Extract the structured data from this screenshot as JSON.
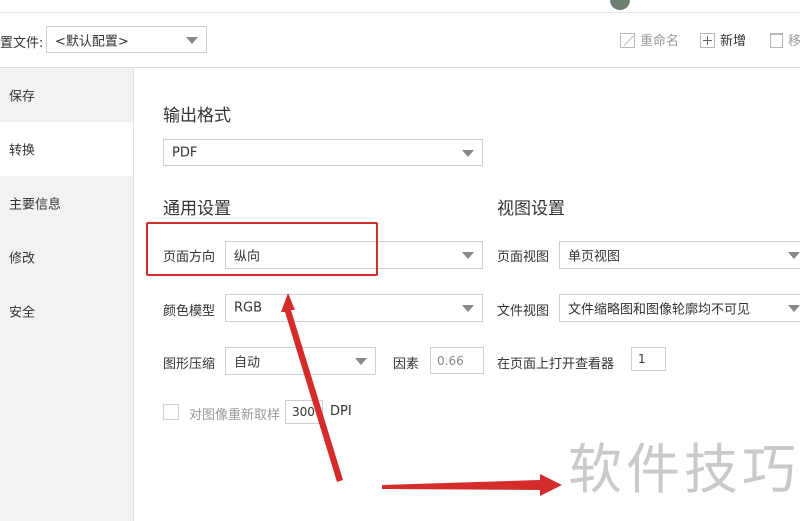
{
  "toolbar": {
    "config_label": "置文件:",
    "config_value": "<默认配置>",
    "rename_label": "重命名",
    "new_label": "新增",
    "delete_label": "移"
  },
  "sidebar": {
    "items": [
      {
        "label": "保存"
      },
      {
        "label": "转换"
      },
      {
        "label": "主要信息"
      },
      {
        "label": "修改"
      },
      {
        "label": "安全"
      }
    ]
  },
  "main": {
    "output_format_title": "输出格式",
    "output_format_value": "PDF",
    "general_title": "通用设置",
    "orientation_label": "页面方向",
    "orientation_value": "纵向",
    "color_label": "颜色模型",
    "color_value": "RGB",
    "compression_label": "图形压缩",
    "compression_value": "自动",
    "factor_label": "因素",
    "factor_value": "0.66",
    "resample_label": "对图像重新取样",
    "resample_value": "300",
    "dpi_label": "DPI",
    "view_title": "视图设置",
    "page_view_label": "页面视图",
    "page_view_value": "单页视图",
    "doc_view_label": "文件视图",
    "doc_view_value": "文件缩略图和图像轮廓均不可见",
    "open_viewer_label": "在页面上打开查看器",
    "open_viewer_value": "1"
  },
  "watermark": "软件技巧",
  "colors": {
    "annotation_red": "#d42b2b",
    "sidebar_gray": "#f2f2f2",
    "watermark": "#c9c9c9"
  }
}
